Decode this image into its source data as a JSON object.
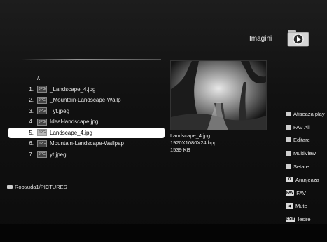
{
  "header": {
    "title": "Imagini",
    "icon": "folder-play-icon"
  },
  "files": {
    "parent": "/..",
    "items": [
      {
        "num": "1.",
        "type": "JPG",
        "name": "_Landscape_4.jpg",
        "selected": false
      },
      {
        "num": "2.",
        "type": "JPG",
        "name": "_Mountain-Landscape-Wallp",
        "selected": false
      },
      {
        "num": "3.",
        "type": "JPG",
        "name": "_yt.jpeg",
        "selected": false
      },
      {
        "num": "4.",
        "type": "JPG",
        "name": "Ideal-landscape.jpg",
        "selected": false
      },
      {
        "num": "5.",
        "type": "JPG",
        "name": "Landscape_4.jpg",
        "selected": true
      },
      {
        "num": "6.",
        "type": "JPG",
        "name": "Mountain-Landscape-Wallpap",
        "selected": false
      },
      {
        "num": "7.",
        "type": "JPG",
        "name": "yt.jpeg",
        "selected": false
      }
    ]
  },
  "path": "Root/uda1/PICTURES",
  "preview": {
    "filename": "Landscape_4.jpg",
    "resolution": "1920X1080X24 bpp",
    "size": "1539 KB"
  },
  "menu": {
    "items": [
      {
        "key": "",
        "label": "Afiseaza play"
      },
      {
        "key": "",
        "label": "FAV All"
      },
      {
        "key": "",
        "label": "Editare"
      },
      {
        "key": "",
        "label": "MultiView"
      },
      {
        "key": "",
        "label": "Setare"
      },
      {
        "key": "0",
        "label": "Aranjeaza"
      },
      {
        "key": "FAV",
        "label": "FAV"
      },
      {
        "key": "◀",
        "label": "Mute"
      },
      {
        "key": "EXIT",
        "label": "Iesire"
      }
    ]
  },
  "colors": {
    "selection": "#ffffff",
    "background": "#111111",
    "text": "#e6e6e6"
  }
}
